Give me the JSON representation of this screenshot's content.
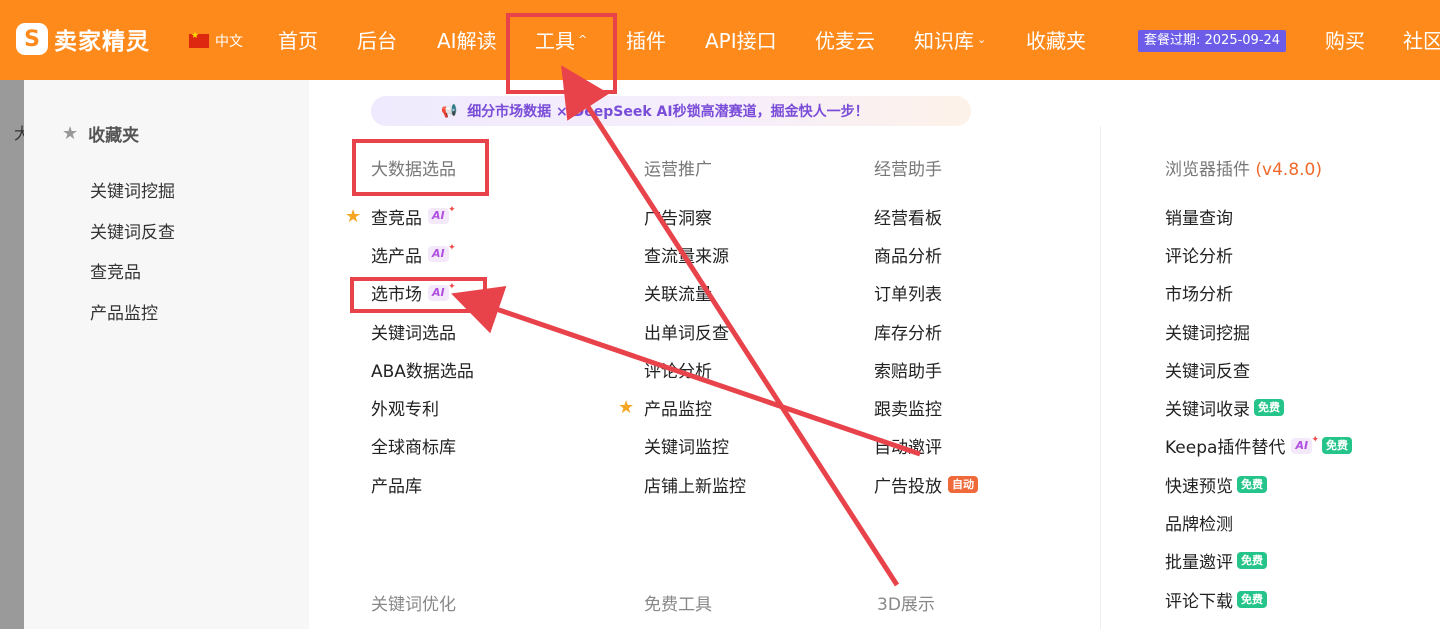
{
  "brand": {
    "logo_letter": "S",
    "name": "卖家精灵"
  },
  "language": {
    "label": "中文"
  },
  "nav": [
    {
      "label": "首页",
      "caret": ""
    },
    {
      "label": "后台",
      "caret": ""
    },
    {
      "label": "AI解读",
      "caret": ""
    },
    {
      "label": "工具",
      "caret": "^"
    },
    {
      "label": "插件",
      "caret": ""
    },
    {
      "label": "API接口",
      "caret": ""
    },
    {
      "label": "优麦云",
      "caret": ""
    },
    {
      "label": "知识库",
      "caret": "⌄"
    },
    {
      "label": "收藏夹",
      "caret": ""
    }
  ],
  "plan_badge": "套餐过期: 2025-09-24",
  "nav_right": [
    {
      "label": "购买"
    },
    {
      "label": "社区"
    }
  ],
  "left_strip_char": "大",
  "favorites": {
    "title": "收藏夹",
    "items": [
      "关键词挖掘",
      "关键词反查",
      "查竞品",
      "产品监控"
    ]
  },
  "announcement": "细分市场数据 × DeepSeek AI秒锁高潜赛道，掘金快人一步！",
  "columns": [
    {
      "title": "大数据选品",
      "items": [
        {
          "label": "查竞品",
          "starred": true,
          "ai": "AI",
          "badge": ""
        },
        {
          "label": "选产品",
          "starred": false,
          "ai": "AI",
          "badge": ""
        },
        {
          "label": "选市场",
          "starred": false,
          "ai": "AI",
          "badge": ""
        },
        {
          "label": "关键词选品",
          "starred": false,
          "ai": "",
          "badge": ""
        },
        {
          "label": "ABA数据选品",
          "starred": false,
          "ai": "",
          "badge": ""
        },
        {
          "label": "外观专利",
          "starred": false,
          "ai": "",
          "badge": ""
        },
        {
          "label": "全球商标库",
          "starred": false,
          "ai": "",
          "badge": ""
        },
        {
          "label": "产品库",
          "starred": false,
          "ai": "",
          "badge": ""
        }
      ]
    },
    {
      "title": "运营推广",
      "items": [
        {
          "label": "广告洞察",
          "starred": false,
          "ai": "",
          "badge": ""
        },
        {
          "label": "查流量来源",
          "starred": false,
          "ai": "",
          "badge": ""
        },
        {
          "label": "关联流量",
          "starred": false,
          "ai": "",
          "badge": ""
        },
        {
          "label": "出单词反查",
          "starred": false,
          "ai": "",
          "badge": ""
        },
        {
          "label": "评论分析",
          "starred": false,
          "ai": "",
          "badge": ""
        },
        {
          "label": "产品监控",
          "starred": true,
          "ai": "",
          "badge": ""
        },
        {
          "label": "关键词监控",
          "starred": false,
          "ai": "",
          "badge": ""
        },
        {
          "label": "店铺上新监控",
          "starred": false,
          "ai": "",
          "badge": ""
        }
      ]
    },
    {
      "title": "经营助手",
      "items": [
        {
          "label": "经营看板",
          "starred": false,
          "ai": "",
          "badge": ""
        },
        {
          "label": "商品分析",
          "starred": false,
          "ai": "",
          "badge": ""
        },
        {
          "label": "订单列表",
          "starred": false,
          "ai": "",
          "badge": ""
        },
        {
          "label": "库存分析",
          "starred": false,
          "ai": "",
          "badge": ""
        },
        {
          "label": "索赔助手",
          "starred": false,
          "ai": "",
          "badge": ""
        },
        {
          "label": "跟卖监控",
          "starred": false,
          "ai": "",
          "badge": ""
        },
        {
          "label": "自动邀评",
          "starred": false,
          "ai": "",
          "badge": ""
        },
        {
          "label": "广告投放",
          "starred": false,
          "ai": "",
          "badge": "自动"
        }
      ]
    },
    {
      "title": "浏览器插件",
      "version": "(v4.8.0)",
      "items": [
        {
          "label": "销量查询",
          "starred": false,
          "ai": "",
          "badge": ""
        },
        {
          "label": "评论分析",
          "starred": false,
          "ai": "",
          "badge": ""
        },
        {
          "label": "市场分析",
          "starred": false,
          "ai": "",
          "badge": ""
        },
        {
          "label": "关键词挖掘",
          "starred": false,
          "ai": "",
          "badge": ""
        },
        {
          "label": "关键词反查",
          "starred": false,
          "ai": "",
          "badge": ""
        },
        {
          "label": "关键词收录",
          "starred": false,
          "ai": "",
          "badge": "免费"
        },
        {
          "label": "Keepa插件替代",
          "starred": false,
          "ai": "AI",
          "badge": "免费"
        },
        {
          "label": "快速预览",
          "starred": false,
          "ai": "",
          "badge": "免费"
        },
        {
          "label": "品牌检测",
          "starred": false,
          "ai": "",
          "badge": ""
        },
        {
          "label": "批量邀评",
          "starred": false,
          "ai": "",
          "badge": "免费"
        },
        {
          "label": "评论下载",
          "starred": false,
          "ai": "",
          "badge": "免费"
        }
      ]
    }
  ],
  "bottom_heads": [
    "关键词优化",
    "免费工具",
    "3D展示"
  ],
  "colors": {
    "nav_bg": "#ff8a1c",
    "annotation": "#e8434a",
    "free": "#24c48a",
    "auto": "#f0693a",
    "plan": "#6c5ce7"
  }
}
